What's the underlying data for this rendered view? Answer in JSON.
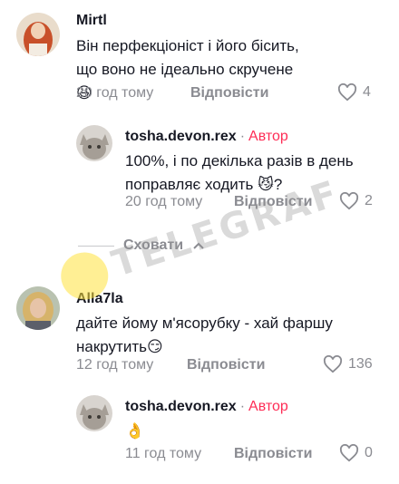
{
  "comments": [
    {
      "username": "Mirtl",
      "text": "Він перфекціоніст і його бісить, що воно не ідеально скручене 😆",
      "time": "20 год тому",
      "reply_label": "Відповісти",
      "likes": "4",
      "avatar_icon": "user-avatar-red-hair"
    },
    {
      "username": "tosha.devon.rex",
      "separator": "·",
      "author_tag": "Автор",
      "text": "100%, і по декілька разів в день поправляє ходить 😼?",
      "time": "20 год тому",
      "reply_label": "Відповісти",
      "likes": "2",
      "avatar_icon": "user-avatar-cat"
    },
    {
      "username": "Alla7la",
      "text": "дайте йому м'ясорубку - хай фаршу накрутить😏",
      "time": "12 год тому",
      "reply_label": "Відповісти",
      "likes": "136",
      "avatar_icon": "user-avatar-blonde"
    },
    {
      "username": "tosha.devon.rex",
      "separator": "·",
      "author_tag": "Автор",
      "text": "👌",
      "time": "11 год тому",
      "reply_label": "Відповісти",
      "likes": "0",
      "avatar_icon": "user-avatar-cat"
    }
  ],
  "hide_replies": {
    "label": "Сховати",
    "icon": "chevron-up-icon"
  },
  "watermark": {
    "text": "TELEGRAF"
  },
  "colors": {
    "author": "#fe2c55",
    "secondary_text": "#8a8b91",
    "primary_text": "#161823"
  }
}
